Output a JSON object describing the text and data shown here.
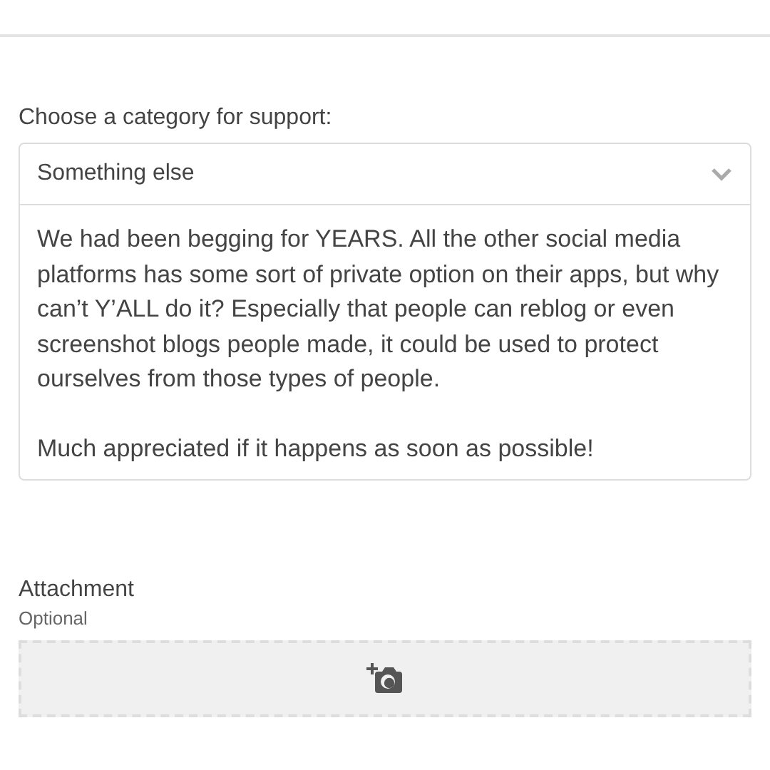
{
  "category": {
    "label": "Choose a category for support:",
    "value": "Something else"
  },
  "message": {
    "value": "We had been begging for YEARS. All the other social media platforms has some sort of private option on their apps, but why can’t Y’ALL do it? Especially that people can reblog or even screenshot blogs people made, it could be used to protect ourselves from those types of people.\n\nMuch appreciated if it happens as soon as possible!"
  },
  "attachment": {
    "label": "Attachment",
    "hint": "Optional"
  }
}
